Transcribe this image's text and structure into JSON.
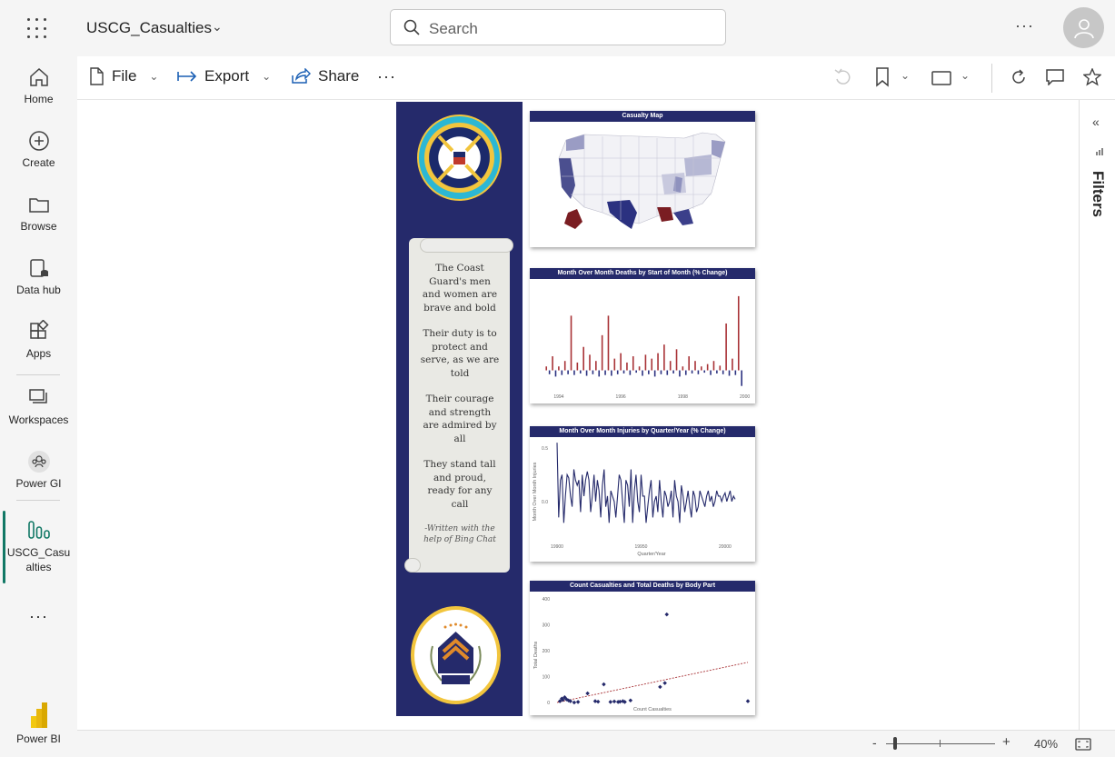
{
  "topbar": {
    "workspace_title": "USCG_Casualties",
    "search_placeholder": "Search"
  },
  "nav": {
    "home": "Home",
    "create": "Create",
    "browse": "Browse",
    "datahub": "Data hub",
    "apps": "Apps",
    "workspaces": "Workspaces",
    "powergi": "Power GI",
    "report": "USCG_Casualties",
    "powerbi": "Power BI"
  },
  "ribbon": {
    "file": "File",
    "export": "Export",
    "share": "Share"
  },
  "filters_label": "Filters",
  "zoom": {
    "label": "40%",
    "value_percent": 40
  },
  "report": {
    "poem": {
      "s1": "The Coast Guard's men and women are brave and bold",
      "s2": "Their duty is to protect and serve, as we are told",
      "s3": "Their courage and strength are admired by all",
      "s4": "They stand tall and proud, ready for any call",
      "credit": "-Written with the help of Bing Chat"
    },
    "map_title": "Casualty Map",
    "colors": {
      "navy": "#252a6b",
      "bar_pos": "#a83236",
      "bar_neg": "#2b3180"
    }
  },
  "chart_data": [
    {
      "type": "bar",
      "title": "Month Over Month Deaths by Start of Month (% Change)",
      "xticks": [
        "1994",
        "1996",
        "1998",
        "2000"
      ],
      "xlim": [
        1993.3,
        2000.1
      ],
      "ylim": [
        -0.25,
        1.1
      ],
      "x": [
        1993.6,
        1993.7,
        1993.8,
        1993.9,
        1994.0,
        1994.1,
        1994.2,
        1994.3,
        1994.4,
        1994.5,
        1994.6,
        1994.7,
        1994.8,
        1994.9,
        1995.0,
        1995.1,
        1995.2,
        1995.3,
        1995.4,
        1995.5,
        1995.6,
        1995.7,
        1995.8,
        1995.9,
        1996.0,
        1996.1,
        1996.2,
        1996.3,
        1996.4,
        1996.5,
        1996.6,
        1996.7,
        1996.8,
        1996.9,
        1997.0,
        1997.1,
        1997.2,
        1997.3,
        1997.4,
        1997.5,
        1997.6,
        1997.7,
        1997.8,
        1997.9,
        1998.0,
        1998.1,
        1998.2,
        1998.3,
        1998.4,
        1998.5,
        1998.6,
        1998.7,
        1998.8,
        1998.9,
        1999.0,
        1999.1,
        1999.2,
        1999.3,
        1999.4,
        1999.5,
        1999.6,
        1999.7,
        1999.8,
        1999.9
      ],
      "values": [
        0.05,
        -0.05,
        0.18,
        -0.08,
        0.05,
        -0.06,
        0.12,
        -0.05,
        0.7,
        -0.06,
        0.1,
        -0.04,
        0.3,
        -0.07,
        0.2,
        -0.05,
        0.12,
        -0.08,
        0.45,
        -0.06,
        0.7,
        -0.07,
        0.15,
        -0.05,
        0.22,
        -0.04,
        0.1,
        -0.06,
        0.18,
        -0.03,
        0.05,
        -0.07,
        0.2,
        -0.05,
        0.15,
        -0.08,
        0.22,
        -0.05,
        0.33,
        -0.06,
        0.12,
        -0.04,
        0.27,
        -0.08,
        0.05,
        -0.06,
        0.18,
        -0.04,
        0.12,
        -0.05,
        0.05,
        -0.03,
        0.08,
        -0.06,
        0.12,
        -0.04,
        0.06,
        -0.05,
        0.6,
        -0.07,
        0.15,
        -0.06,
        0.95,
        -0.2
      ]
    },
    {
      "type": "line",
      "title": "Month Over Month Injuries by Quarter/Year (% Change)",
      "xlabel": "Quarter/Year",
      "ylabel": "Month Over Month Injuries",
      "xticks": [
        "19900",
        "19950",
        "20000"
      ],
      "yticks": [
        "0.5",
        "0.0"
      ],
      "ylim": [
        -0.3,
        0.5
      ],
      "x": [
        19900,
        19901,
        19902,
        19903,
        19904,
        19905,
        19906,
        19907,
        19908,
        19909,
        19910,
        19911,
        19912,
        19913,
        19914,
        19915,
        19916,
        19917,
        19918,
        19919,
        19920,
        19921,
        19922,
        19923,
        19924,
        19925,
        19926,
        19927,
        19928,
        19929,
        19930,
        19931,
        19932,
        19933,
        19934,
        19935,
        19936,
        19937,
        19938,
        19939,
        19940,
        19941,
        19942,
        19943,
        19944,
        19945,
        19946,
        19947,
        19948,
        19949,
        19950,
        19951,
        19952,
        19953,
        19954,
        19955,
        19956,
        19957,
        19958,
        19959,
        19960,
        19961,
        19962,
        19963,
        19964,
        19965,
        19966,
        19967,
        19968,
        19969,
        19970,
        19971,
        19972,
        19973,
        19974,
        19975,
        19976,
        19977,
        19978,
        19979,
        19980,
        19981,
        19982,
        19983,
        19984,
        19985,
        19986,
        19987,
        19988,
        19989,
        19990,
        19991,
        19992,
        19993,
        19994,
        19995,
        19996,
        19997,
        19998,
        19999,
        20000,
        20001,
        20002,
        20003,
        20004,
        20005,
        20006
      ],
      "values": [
        0.55,
        -0.15,
        0.2,
        0.25,
        -0.2,
        0.05,
        0.25,
        0.22,
        0.05,
        -0.05,
        0.3,
        0.2,
        0.15,
        0.2,
        -0.1,
        0.25,
        0.05,
        0.2,
        0.28,
        0.2,
        -0.1,
        0.05,
        0.25,
        0.0,
        0.2,
        0.1,
        -0.15,
        0.15,
        0.3,
        -0.05,
        0.05,
        -0.2,
        0.1,
        0.05,
        0.0,
        -0.15,
        0.05,
        0.25,
        0.2,
        0.0,
        -0.2,
        0.2,
        0.15,
        -0.05,
        0.3,
        -0.2,
        0.1,
        0.25,
        0.0,
        -0.1,
        0.25,
        0.05,
        0.05,
        -0.2,
        -0.05,
        0.1,
        0.2,
        -0.15,
        0.0,
        0.05,
        -0.1,
        0.2,
        0.0,
        -0.15,
        0.1,
        0.05,
        -0.05,
        0.0,
        0.1,
        -0.15,
        0.2,
        0.05,
        0.0,
        -0.2,
        0.15,
        0.05,
        -0.1,
        0.0,
        0.1,
        -0.05,
        -0.15,
        0.1,
        0.05,
        -0.1,
        -0.05,
        0.1,
        0.05,
        0.0,
        -0.05,
        0.05,
        0.1,
        0.0,
        0.05,
        -0.05,
        0.0,
        0.1,
        0.05,
        0.05,
        0.0,
        0.05,
        0.08,
        0.0,
        0.05,
        0.1,
        0.0,
        0.05,
        0.02
      ]
    },
    {
      "type": "scatter",
      "title": "Count Casualties and Total Deaths by Body Part",
      "xlabel": "Count Casualties",
      "ylabel": "Total Deaths",
      "yticks": [
        "0",
        "100",
        "200",
        "300",
        "400"
      ],
      "ylim": [
        0,
        400
      ],
      "xlim": [
        0,
        1000
      ],
      "x": [
        15,
        25,
        30,
        40,
        50,
        60,
        70,
        90,
        110,
        160,
        200,
        215,
        245,
        280,
        300,
        320,
        330,
        345,
        355,
        385,
        540,
        565,
        575,
        1000
      ],
      "values": [
        5,
        15,
        10,
        20,
        12,
        8,
        5,
        0,
        2,
        35,
        5,
        3,
        70,
        2,
        4,
        2,
        3,
        5,
        2,
        8,
        60,
        75,
        340,
        5
      ],
      "trendline": {
        "x": [
          0,
          1000
        ],
        "y": [
          0,
          155
        ],
        "color": "#a83236",
        "style": "dashed"
      }
    }
  ]
}
